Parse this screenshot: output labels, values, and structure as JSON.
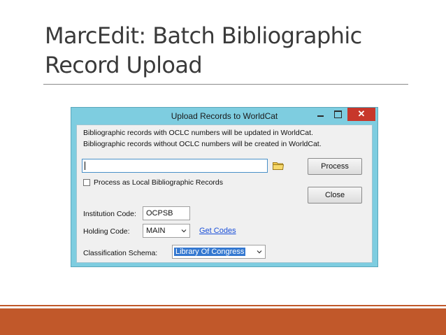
{
  "slide": {
    "title_line1": "MarcEdit: Batch Bibliographic",
    "title_line2": "Record Upload"
  },
  "window": {
    "title": "Upload Records to WorldCat",
    "close_glyph": "✕",
    "info_line1": "Bibliographic records with OCLC numbers will be updated in WorldCat.",
    "info_line2": "Bibliographic records without OCLC numbers will be created in WorldCat.",
    "file_path_value": "",
    "process_button_label": "Process",
    "close_button_label": "Close",
    "local_records_checkbox_label": "Process as Local Bibliographic Records",
    "local_records_checked": false,
    "institution_code_label": "Institution Code:",
    "institution_code_value": "OCPSB",
    "holding_code_label": "Holding Code:",
    "holding_code_value": "MAIN",
    "get_codes_link": "Get Codes",
    "classification_schema_label": "Classification Schema:",
    "classification_schema_value": "Library Of Congress"
  },
  "icons": {
    "browse": "folder-icon",
    "minimize": "minimize-icon",
    "maximize": "maximize-icon",
    "close": "close-icon",
    "dropdown": "chevron-down-icon"
  },
  "colors": {
    "window_frame": "#7ecde0",
    "close_button": "#c7372b",
    "selection": "#3478d0",
    "link": "#1a4fd8",
    "footer_accent": "#c1582a"
  }
}
